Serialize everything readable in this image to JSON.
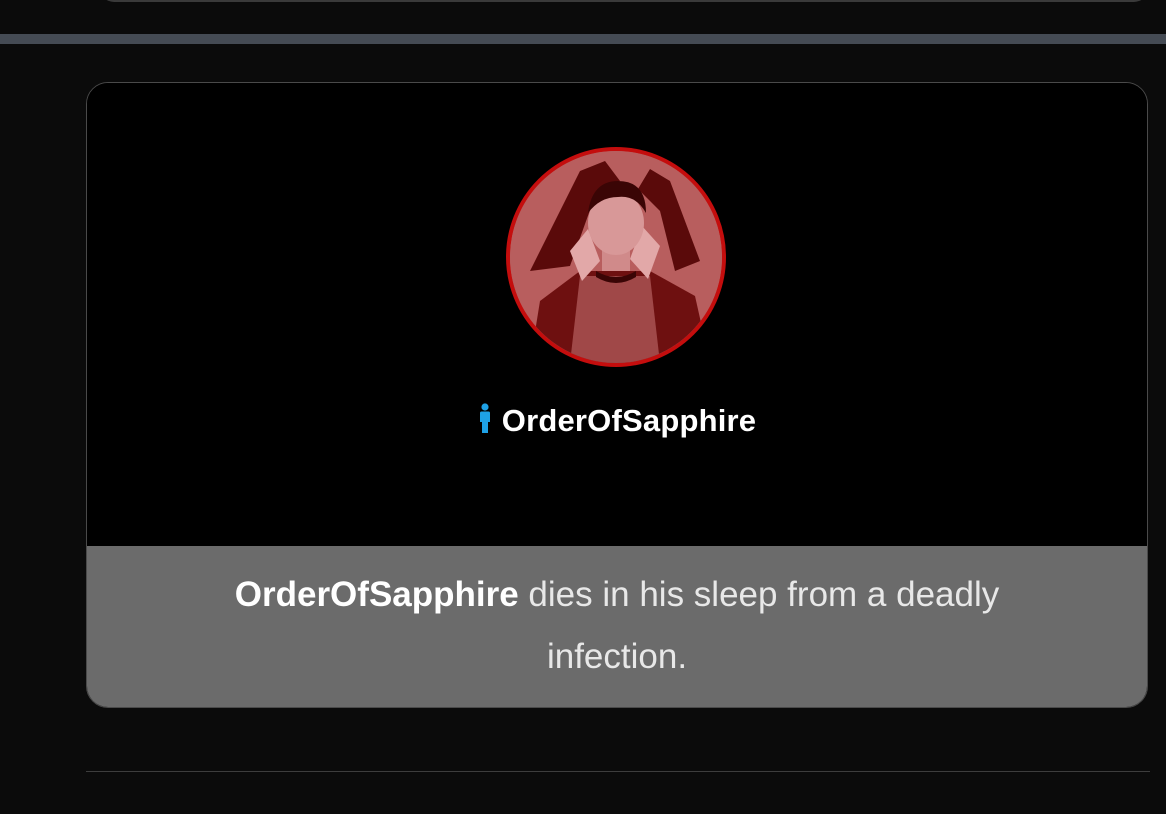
{
  "tribute": {
    "name": "OrderOfSapphire",
    "gender_icon": "male-person-icon",
    "avatar_alt": "avatar"
  },
  "event": {
    "actor": "OrderOfSapphire",
    "text_line1": " dies in his sleep from a deadly",
    "text_line2": "infection."
  },
  "colors": {
    "page_bg": "#0b0b0b",
    "card_bg": "#000000",
    "message_bg": "#6b6b6b",
    "avatar_ring": "#c40d0d",
    "gender_icon": "#1ea1e6",
    "divider": "#454b54"
  }
}
